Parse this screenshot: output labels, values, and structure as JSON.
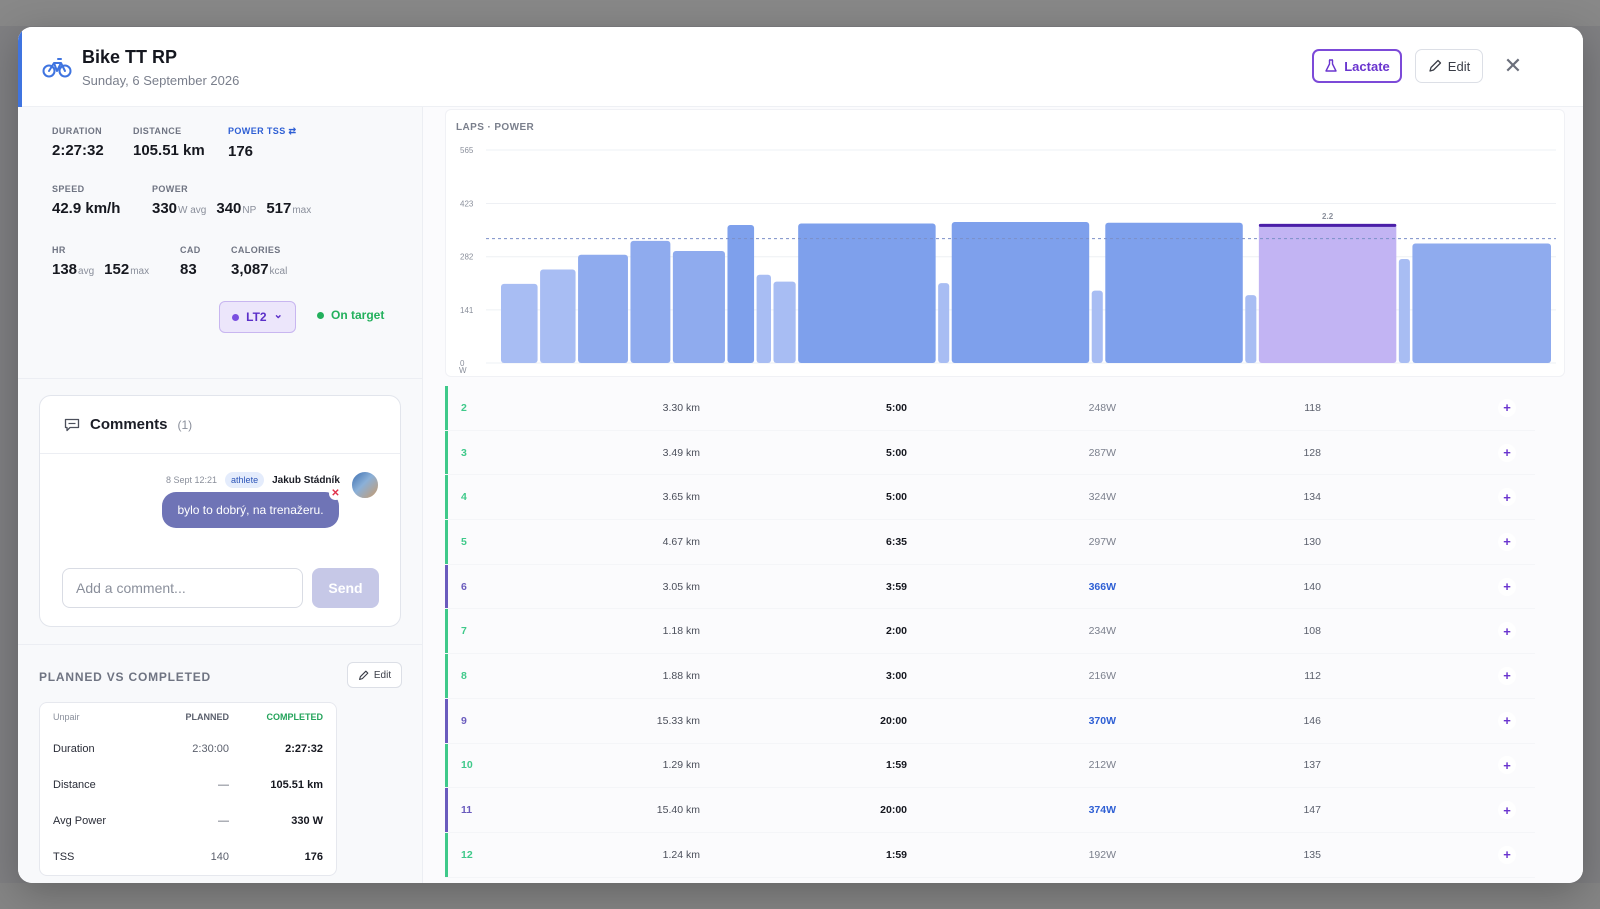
{
  "header": {
    "title": "Bike TT RP",
    "date": "Sunday, 6 September 2026",
    "lactate_label": "Lactate",
    "edit_label": "Edit",
    "close_glyph": "✕",
    "icon": "bike-icon"
  },
  "stats": {
    "duration": {
      "label": "DURATION",
      "value": "2:27:32"
    },
    "distance": {
      "label": "DISTANCE",
      "value": "105.51 km"
    },
    "power_tss": {
      "label": "POWER TSS ⇄",
      "value": "176"
    },
    "speed": {
      "label": "SPEED",
      "value": "42.9 km/h"
    },
    "power": {
      "label": "POWER",
      "avg": "330",
      "avg_unit": "W avg",
      "np": "340",
      "np_unit": "NP",
      "max": "517",
      "max_unit": "max"
    },
    "hr": {
      "label": "HR",
      "avg": "138",
      "avg_unit": "avg",
      "max": "152",
      "max_unit": "max"
    },
    "cad": {
      "label": "CAD",
      "value": "83"
    },
    "calories": {
      "label": "CALORIES",
      "value": "3,087",
      "unit": "kcal"
    },
    "zone": "LT2",
    "zone_chevron": "⌄",
    "status": "On target"
  },
  "comments": {
    "title": "Comments",
    "count": "(1)",
    "items": [
      {
        "time": "8 Sept 12:21",
        "role": "athlete",
        "author": "Jakub Stádník",
        "text": "bylo to dobrý, na trenažeru."
      }
    ],
    "delete_glyph": "✕",
    "input_placeholder": "Add a comment...",
    "send_label": "Send"
  },
  "planned_vs_completed": {
    "title": "PLANNED VS COMPLETED",
    "edit_label": "Edit",
    "columns": [
      "Unpair",
      "PLANNED",
      "COMPLETED"
    ],
    "rows": [
      {
        "metric": "Duration",
        "planned": "2:30:00",
        "completed": "2:27:32"
      },
      {
        "metric": "Distance",
        "planned": "—",
        "completed": "105.51 km"
      },
      {
        "metric": "Avg Power",
        "planned": "—",
        "completed": "330 W"
      },
      {
        "metric": "TSS",
        "planned": "140",
        "completed": "176"
      }
    ]
  },
  "chart_data": {
    "type": "bar",
    "title": "LAPS · POWER",
    "yticks": [
      "565",
      "423",
      "282",
      "141",
      "0"
    ],
    "yunit": "W",
    "ylim": [
      0,
      565
    ],
    "reference_line": 330,
    "highlight_label": "2.2",
    "bars": [
      {
        "power": 210,
        "duration_min": 3.3
      },
      {
        "power": 248,
        "duration_min": 3.2
      },
      {
        "power": 287,
        "duration_min": 4.5
      },
      {
        "power": 324,
        "duration_min": 3.6
      },
      {
        "power": 297,
        "duration_min": 4.7
      },
      {
        "power": 366,
        "duration_min": 2.4
      },
      {
        "power": 234,
        "duration_min": 1.3
      },
      {
        "power": 216,
        "duration_min": 2.0
      },
      {
        "power": 370,
        "duration_min": 12.4
      },
      {
        "power": 212,
        "duration_min": 1.0
      },
      {
        "power": 374,
        "duration_min": 12.4
      },
      {
        "power": 192,
        "duration_min": 1.0
      },
      {
        "power": 372,
        "duration_min": 12.4
      },
      {
        "power": 180,
        "duration_min": 1.0
      },
      {
        "power": 369,
        "duration_min": 12.4
      },
      {
        "power": 276,
        "duration_min": 1.0
      },
      {
        "power": 317,
        "duration_min": 12.5
      }
    ],
    "colors": {
      "low": "#a8bdf3",
      "mid": "#8fabee",
      "high": "#7ea0ec",
      "highlight": "#c2b4f3",
      "highlight_top": "#4a1ea8"
    }
  },
  "laps": {
    "rows": [
      {
        "lap": "2",
        "distance": "3.30 km",
        "time": "5:00",
        "power": "248W",
        "hr": "118",
        "hot": false
      },
      {
        "lap": "3",
        "distance": "3.49 km",
        "time": "5:00",
        "power": "287W",
        "hr": "128",
        "hot": false
      },
      {
        "lap": "4",
        "distance": "3.65 km",
        "time": "5:00",
        "power": "324W",
        "hr": "134",
        "hot": false
      },
      {
        "lap": "5",
        "distance": "4.67 km",
        "time": "6:35",
        "power": "297W",
        "hr": "130",
        "hot": false
      },
      {
        "lap": "6",
        "distance": "3.05 km",
        "time": "3:59",
        "power": "366W",
        "hr": "140",
        "hot": true
      },
      {
        "lap": "7",
        "distance": "1.18 km",
        "time": "2:00",
        "power": "234W",
        "hr": "108",
        "hot": false
      },
      {
        "lap": "8",
        "distance": "1.88 km",
        "time": "3:00",
        "power": "216W",
        "hr": "112",
        "hot": false
      },
      {
        "lap": "9",
        "distance": "15.33 km",
        "time": "20:00",
        "power": "370W",
        "hr": "146",
        "hot": true
      },
      {
        "lap": "10",
        "distance": "1.29 km",
        "time": "1:59",
        "power": "212W",
        "hr": "137",
        "hot": false
      },
      {
        "lap": "11",
        "distance": "15.40 km",
        "time": "20:00",
        "power": "374W",
        "hr": "147",
        "hot": true
      },
      {
        "lap": "12",
        "distance": "1.24 km",
        "time": "1:59",
        "power": "192W",
        "hr": "135",
        "hot": false
      }
    ],
    "add_glyph": "+",
    "colors": {
      "easy": "#3fc98a",
      "hard": "#6a5bbd"
    }
  }
}
